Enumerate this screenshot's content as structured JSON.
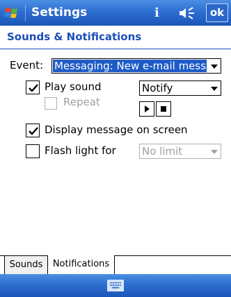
{
  "titlebar": {
    "title": "Settings",
    "info_indicator": "i",
    "ok_label": "ok",
    "logo_icon": "windows-flag-icon",
    "volume_icon": "speaker-volume-icon",
    "colors": {
      "bar": "#2d6fd0"
    }
  },
  "header": {
    "title": "Sounds & Notifications"
  },
  "event": {
    "label": "Event:",
    "selected": "Messaging: New e-mail messag"
  },
  "play_sound": {
    "label": "Play sound",
    "checked": true,
    "sound_value": "Notify",
    "repeat_label": "Repeat",
    "repeat_checked": false,
    "repeat_enabled": false
  },
  "display_message": {
    "label": "Display message on screen",
    "checked": true
  },
  "flash_light": {
    "label": "Flash light for",
    "checked": false,
    "duration_value": "No limit",
    "duration_enabled": false
  },
  "tabs": [
    {
      "label": "Sounds",
      "active": false
    },
    {
      "label": "Notifications",
      "active": true
    }
  ],
  "bottombar": {
    "keyboard_icon": "keyboard-icon"
  }
}
